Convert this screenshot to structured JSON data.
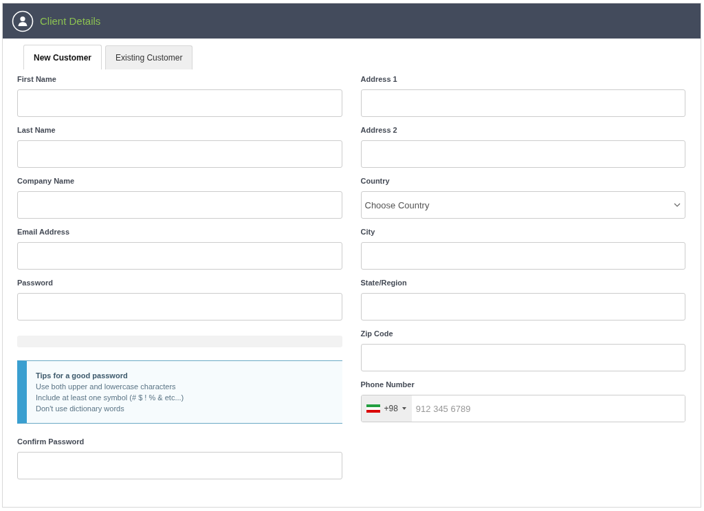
{
  "header": {
    "title": "Client Details"
  },
  "tabs": [
    {
      "label": "New Customer",
      "selected": true
    },
    {
      "label": "Existing Customer",
      "selected": false
    }
  ],
  "left_column": [
    {
      "kind": "input",
      "label": "First Name"
    },
    {
      "kind": "input",
      "label": "Last Name"
    },
    {
      "kind": "input",
      "label": "Company Name"
    },
    {
      "kind": "input",
      "label": "Email Address"
    },
    {
      "kind": "input",
      "label": "Password"
    },
    {
      "kind": "meter",
      "level": 0
    },
    {
      "kind": "tips",
      "title": "Tips for a good password",
      "lines": [
        "Use both upper and lowercase characters",
        "Include at least one symbol (# $ ! % & etc...)",
        "Don't use dictionary words"
      ]
    },
    {
      "kind": "input",
      "label": "Confirm Password"
    }
  ],
  "right_column": [
    {
      "kind": "input",
      "label": "Address 1"
    },
    {
      "kind": "input",
      "label": "Address 2"
    },
    {
      "kind": "select",
      "label": "Country",
      "placeholder": "Choose Country"
    },
    {
      "kind": "input",
      "label": "City"
    },
    {
      "kind": "input",
      "label": "State/Region"
    },
    {
      "kind": "input",
      "label": "Zip Code"
    },
    {
      "kind": "phone",
      "label": "Phone Number",
      "dial_code": "+98",
      "placeholder": "912 345 6789"
    }
  ]
}
